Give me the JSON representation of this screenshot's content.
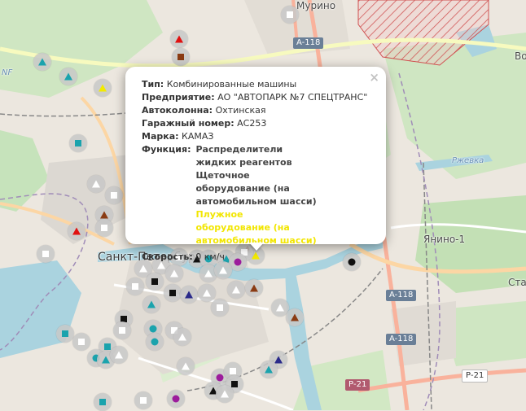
{
  "map": {
    "labels": {
      "murino": "Мурино",
      "spb": "Санкт-Петербург",
      "yanino": "Янино-1",
      "star": "Стар",
      "vo": "Во",
      "rzhevka": "Ржевка",
      "nf": "NF"
    },
    "shields": {
      "a118_1": "A-118",
      "a118_2": "A-118",
      "a118_3": "A-118",
      "r21_1": "Р-21",
      "r21_2": "Р-21"
    }
  },
  "popup": {
    "close": "×",
    "type_label": "Тип:",
    "type_value": "Комбинированные машины",
    "company_label": "Предприятие:",
    "company_value": "АО \"АВТОПАРК №7 СПЕЦТРАНС\"",
    "convoy_label": "Автоколонна:",
    "convoy_value": "Охтинская",
    "garage_label": "Гаражный номер:",
    "garage_value": "АС253",
    "brand_label": "Марка:",
    "brand_value": "КАМАЗ",
    "function_label": "Функция:",
    "function_part1": "Распределители жидких реагентов Щеточное оборудование (на автомобильном шасси)",
    "function_part2": "Плужное оборудование (на автомобильном шасси)",
    "speed_label": "Скорость:",
    "speed_value": "0 км/ч"
  },
  "colors": {
    "teal": "#1aa3ad",
    "white": "#ffffff",
    "black": "#111111",
    "red": "#e01010",
    "brown": "#8a3b13",
    "purple": "#9c1c9c",
    "navy": "#2a2a8a",
    "yellow": "#f2ea00",
    "highlight": "#f2e600"
  }
}
